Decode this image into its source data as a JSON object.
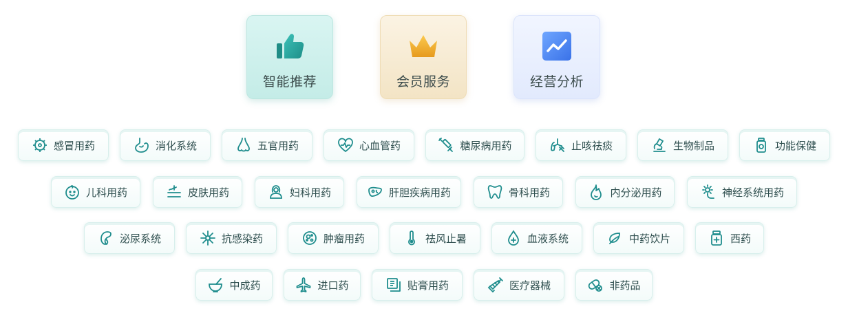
{
  "features": [
    {
      "label": "智能推荐",
      "icon": "thumbs-up-icon"
    },
    {
      "label": "会员服务",
      "icon": "crown-icon"
    },
    {
      "label": "经营分析",
      "icon": "trend-chart-icon"
    }
  ],
  "categories": {
    "row1": [
      {
        "label": "感冒用药",
        "icon": "virus-icon"
      },
      {
        "label": "消化系统",
        "icon": "stomach-icon"
      },
      {
        "label": "五官用药",
        "icon": "nose-icon"
      },
      {
        "label": "心血管药",
        "icon": "heartbeat-icon"
      },
      {
        "label": "糖尿病用药",
        "icon": "syringe-icon"
      },
      {
        "label": "止咳祛痰",
        "icon": "lungs-icon"
      },
      {
        "label": "生物制品",
        "icon": "microscope-icon"
      },
      {
        "label": "功能保健",
        "icon": "supplement-bottle-icon"
      }
    ],
    "row2": [
      {
        "label": "儿科用药",
        "icon": "baby-face-icon"
      },
      {
        "label": "皮肤用药",
        "icon": "skin-layers-icon"
      },
      {
        "label": "妇科用药",
        "icon": "woman-icon"
      },
      {
        "label": "肝胆疾病用药",
        "icon": "liver-icon"
      },
      {
        "label": "骨科用药",
        "icon": "tooth-bone-icon"
      },
      {
        "label": "内分泌用药",
        "icon": "drop-flame-icon"
      },
      {
        "label": "神经系统用药",
        "icon": "neuron-gear-icon"
      }
    ],
    "row3": [
      {
        "label": "泌尿系统",
        "icon": "kidney-icon"
      },
      {
        "label": "抗感染药",
        "icon": "bacteria-icon"
      },
      {
        "label": "肿瘤用药",
        "icon": "tumor-cell-icon"
      },
      {
        "label": "祛风止暑",
        "icon": "thermometer-icon"
      },
      {
        "label": "血液系统",
        "icon": "blood-drop-icon"
      },
      {
        "label": "中药饮片",
        "icon": "herbal-leaf-icon"
      },
      {
        "label": "西药",
        "icon": "pill-bottle-icon"
      }
    ],
    "row4": [
      {
        "label": "中成药",
        "icon": "mortar-icon"
      },
      {
        "label": "进口药",
        "icon": "airplane-icon"
      },
      {
        "label": "贴膏用药",
        "icon": "patch-icon"
      },
      {
        "label": "医疗器械",
        "icon": "injector-icon"
      },
      {
        "label": "非药品",
        "icon": "capsule-cross-icon"
      }
    ]
  },
  "colors": {
    "accent": "#1f8d8d",
    "thumb": "#2ea9a2",
    "crown": "#f0b43a",
    "chart": "#4b86f2"
  }
}
